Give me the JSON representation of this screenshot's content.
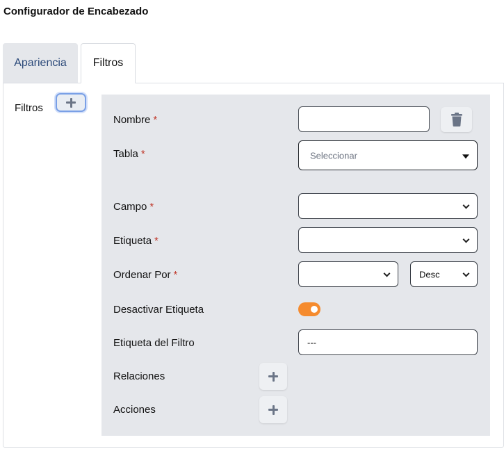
{
  "page": {
    "title": "Configurador de Encabezado"
  },
  "tabs": [
    {
      "label": "Apariencia",
      "active": false
    },
    {
      "label": "Filtros",
      "active": true
    }
  ],
  "filters_section": {
    "label": "Filtros",
    "add_icon": "plus-icon"
  },
  "form": {
    "nombre": {
      "label": "Nombre",
      "required": "*",
      "value": ""
    },
    "delete_icon": "trash-icon",
    "tabla": {
      "label": "Tabla",
      "required": "*",
      "placeholder": "Seleccionar"
    },
    "campo": {
      "label": "Campo",
      "required": "*",
      "value": ""
    },
    "etiqueta": {
      "label": "Etiqueta",
      "required": "*",
      "value": ""
    },
    "ordenar_por": {
      "label": "Ordenar Por",
      "required": "*",
      "value": "",
      "direction": "Desc"
    },
    "desactivar_etiqueta": {
      "label": "Desactivar Etiqueta",
      "enabled": true
    },
    "etiqueta_filtro": {
      "label": "Etiqueta del Filtro",
      "value": "---"
    },
    "relaciones": {
      "label": "Relaciones",
      "add_icon": "plus-icon"
    },
    "acciones": {
      "label": "Acciones",
      "add_icon": "plus-icon"
    }
  },
  "colors": {
    "toggle_on": "#f58b2e",
    "card_background": "#e5e7eb",
    "required_marker": "#c0392b",
    "add_button_focus": "#7aa0e6"
  }
}
